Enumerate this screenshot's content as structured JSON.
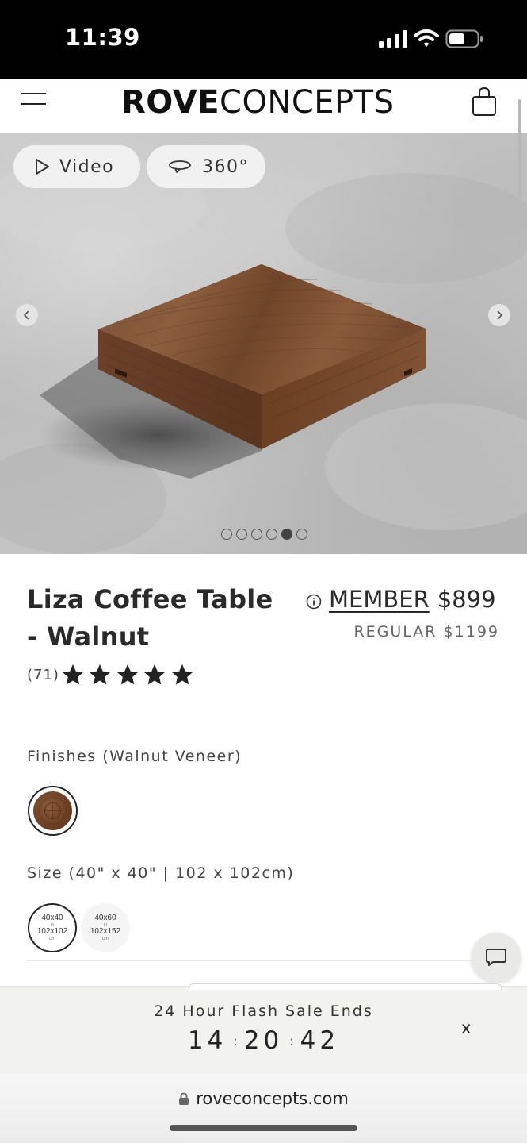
{
  "status_bar": {
    "time": "11:39"
  },
  "header": {
    "logo_bold": "ROVE",
    "logo_light": "CONCEPTS"
  },
  "gallery": {
    "video_label": "Video",
    "spin_label": "360°",
    "dots_total": 6,
    "active_dot": 5
  },
  "product": {
    "title": "Liza Coffee Table - Walnut",
    "member_label": "MEMBER",
    "member_price": "$899",
    "regular_price": "REGULAR $1199",
    "review_count": "(71)",
    "rating": 5
  },
  "options": {
    "finishes_label": "Finishes (Walnut Veneer)",
    "size_label": "Size (40\" x 40\" | 102 x 102cm)",
    "sizes": [
      {
        "top": "40x40",
        "mid": "in",
        "bottom": "102x102",
        "unit": "cm"
      },
      {
        "top": "40x60",
        "mid": "in",
        "bottom": "102x152",
        "unit": "cm"
      }
    ]
  },
  "flash_sale": {
    "title": "24 Hour Flash Sale Ends",
    "hours": "14",
    "minutes": "20",
    "seconds": "42",
    "close_label": "x"
  },
  "browser": {
    "url": "roveconcepts.com"
  },
  "icons": {
    "menu": "menu-icon",
    "cart": "shopping-bag-icon",
    "video": "play-icon",
    "spin": "rotate-360-icon",
    "info": "info-icon",
    "chat": "chat-icon",
    "lock": "lock-icon"
  }
}
